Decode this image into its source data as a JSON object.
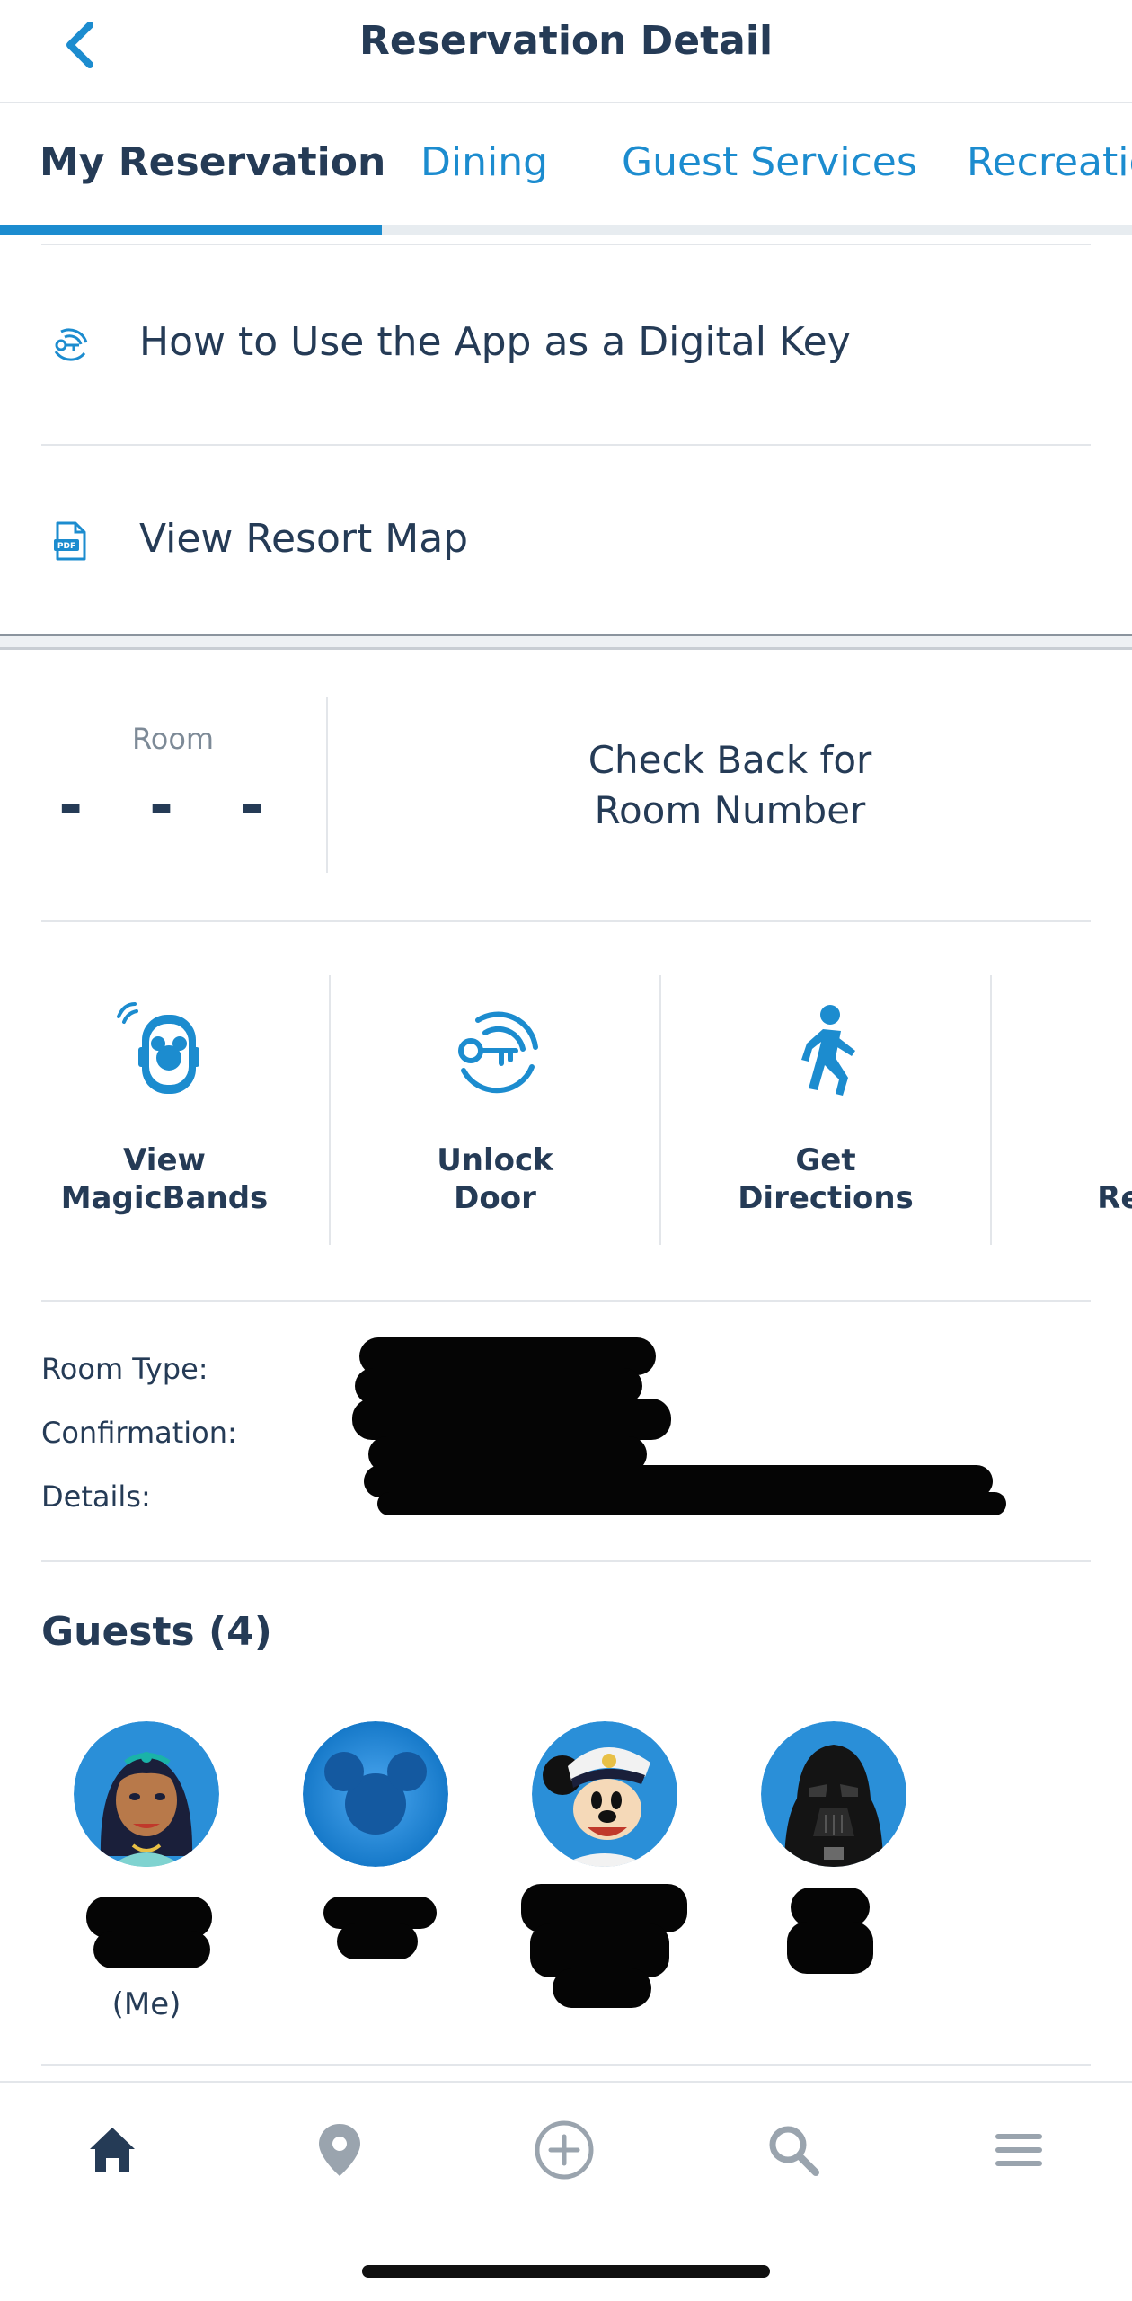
{
  "header": {
    "title": "Reservation Detail",
    "back_icon": "chevron-left-icon"
  },
  "tabs": [
    {
      "label": "My Reservation",
      "active": true
    },
    {
      "label": "Dining",
      "active": false
    },
    {
      "label": "Guest Services",
      "active": false
    },
    {
      "label": "Recreatio",
      "active": false
    }
  ],
  "links": [
    {
      "label": "How to Use the App as a Digital Key",
      "icon": "digital-key-icon"
    },
    {
      "label": "View Resort Map",
      "icon": "pdf-icon"
    }
  ],
  "room": {
    "label": "Room",
    "value": "- - -",
    "message_line1": "Check Back for",
    "message_line2": "Room Number"
  },
  "actions": [
    {
      "line1": "View",
      "line2": "MagicBands",
      "icon": "magicband-icon"
    },
    {
      "line1": "Unlock",
      "line2": "Door",
      "icon": "unlock-key-icon"
    },
    {
      "line1": "Get",
      "line2": "Directions",
      "icon": "walking-person-icon"
    },
    {
      "line1": "(",
      "line2": "Reso",
      "icon": "partial-icon"
    }
  ],
  "details": {
    "room_type_label": "Room Type:",
    "confirmation_label": "Confirmation:",
    "details_label": "Details:"
  },
  "guests": {
    "title": "Guests (4)",
    "me_label": "(Me)",
    "avatars": [
      "jasmine-avatar",
      "mickey-head-avatar",
      "captain-mickey-avatar",
      "darth-vader-avatar"
    ]
  },
  "bottom_nav": [
    "home-icon",
    "location-pin-icon",
    "add-plus-icon",
    "search-icon",
    "menu-icon"
  ],
  "colors": {
    "accent": "#1c8ccf",
    "text": "#253b56",
    "muted": "#7d8a97",
    "divider": "#e3e6ea"
  }
}
